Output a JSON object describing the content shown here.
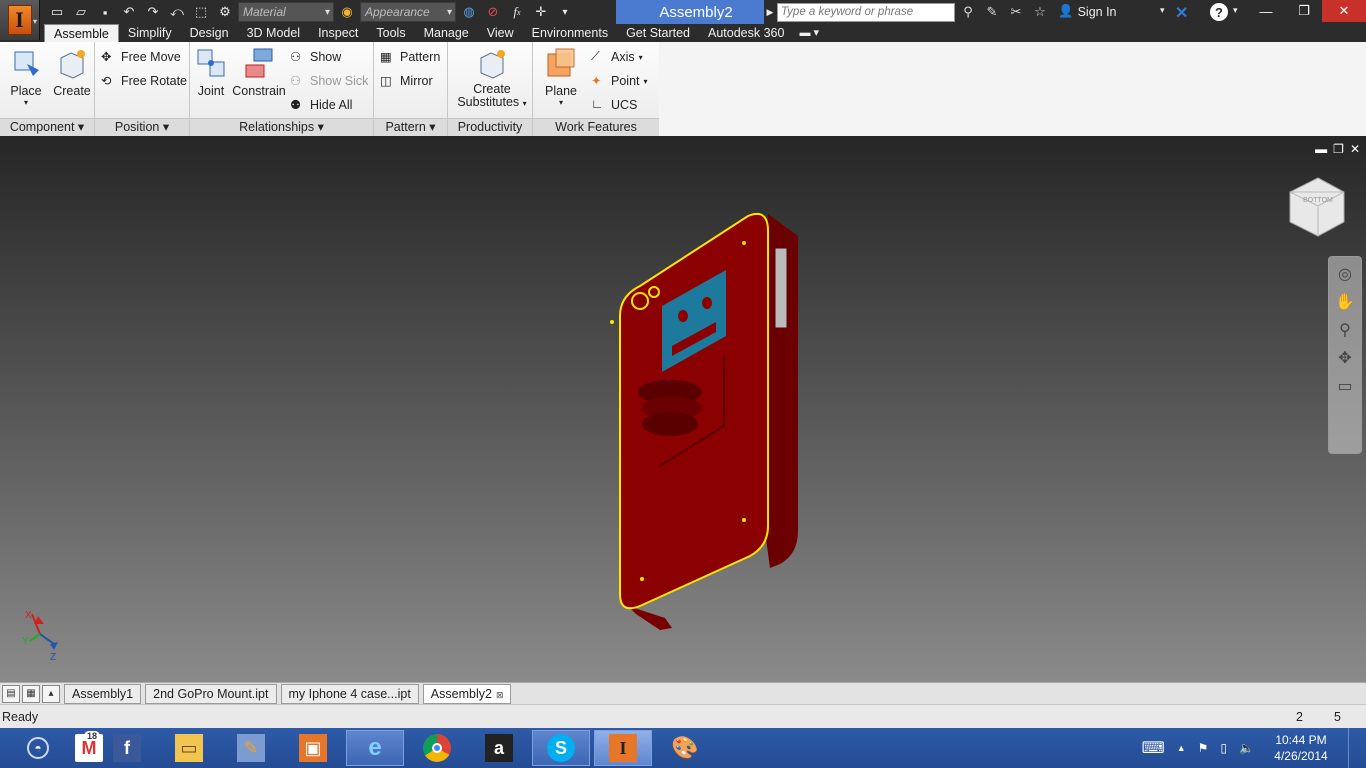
{
  "app": {
    "name": "Autodesk Inventor",
    "logo_letter": "I"
  },
  "titlebar": {
    "material_placeholder": "Material",
    "appearance_placeholder": "Appearance",
    "doc_title": "Assembly2",
    "search_placeholder": "Type a keyword or phrase",
    "signin": "Sign In"
  },
  "tabs": [
    {
      "label": "Assemble",
      "active": true
    },
    {
      "label": "Simplify"
    },
    {
      "label": "Design"
    },
    {
      "label": "3D Model"
    },
    {
      "label": "Inspect"
    },
    {
      "label": "Tools"
    },
    {
      "label": "Manage"
    },
    {
      "label": "View"
    },
    {
      "label": "Environments"
    },
    {
      "label": "Get Started"
    },
    {
      "label": "Autodesk 360"
    }
  ],
  "ribbon": {
    "component": {
      "title": "Component",
      "place": "Place",
      "create": "Create"
    },
    "position": {
      "title": "Position",
      "free_move": "Free Move",
      "free_rotate": "Free Rotate"
    },
    "relationships": {
      "title": "Relationships",
      "joint": "Joint",
      "constrain": "Constrain",
      "show": "Show",
      "show_sick": "Show Sick",
      "hide_all": "Hide All"
    },
    "pattern": {
      "title": "Pattern",
      "pattern": "Pattern",
      "mirror": "Mirror"
    },
    "productivity": {
      "title": "Productivity",
      "create_substitutes_1": "Create",
      "create_substitutes_2": "Substitutes"
    },
    "work_features": {
      "title": "Work Features",
      "plane": "Plane",
      "axis": "Axis",
      "point": "Point",
      "ucs": "UCS"
    }
  },
  "viewcube": {
    "face_label": "BOTTOM"
  },
  "triad": {
    "x": "X",
    "y": "Y",
    "z": "Z"
  },
  "doc_tabs": [
    {
      "label": "Assembly1"
    },
    {
      "label": "2nd GoPro Mount.ipt"
    },
    {
      "label": "my Iphone 4 case...ipt"
    },
    {
      "label": "Assembly2",
      "active": true,
      "closable": true
    }
  ],
  "status": {
    "text": "Ready",
    "num1": "2",
    "num2": "5"
  },
  "taskbar": {
    "gmail_badge": "18",
    "clock_time": "10:44 PM",
    "clock_date": "4/26/2014"
  },
  "colors": {
    "accent": "#4a7bd0",
    "model_red": "#8b0000",
    "highlight": "#ffe600",
    "screen_blue": "#1e7a9c"
  }
}
